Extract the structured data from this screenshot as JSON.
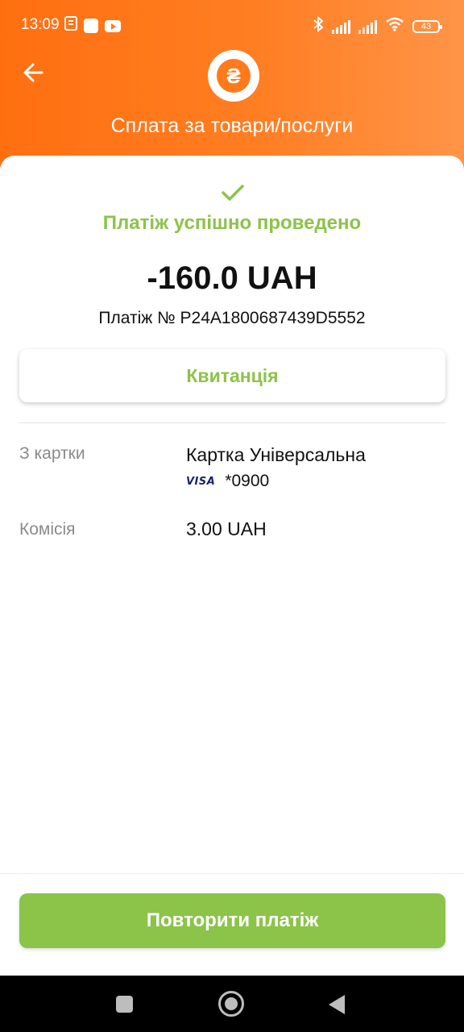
{
  "status_bar": {
    "time": "13:09",
    "battery": "43"
  },
  "header": {
    "title": "Сплата за товари/послуги",
    "logo_glyph": "₴",
    "accent_color": "#ff7a1a"
  },
  "result": {
    "status_text": "Платіж успішно проведено",
    "amount": "-160.0 UAH",
    "payment_number": "Платіж № P24A1800687439D5552",
    "status_color": "#8cc349"
  },
  "receipt_button": {
    "label": "Квитанція"
  },
  "details": {
    "from_card_label": "З картки",
    "card_name": "Картка Універсальна",
    "card_brand": "VISA",
    "card_mask": "*0900",
    "commission_label": "Комісія",
    "commission_value": "3.00 UAH"
  },
  "repeat_button": {
    "label": "Повторити платіж"
  }
}
